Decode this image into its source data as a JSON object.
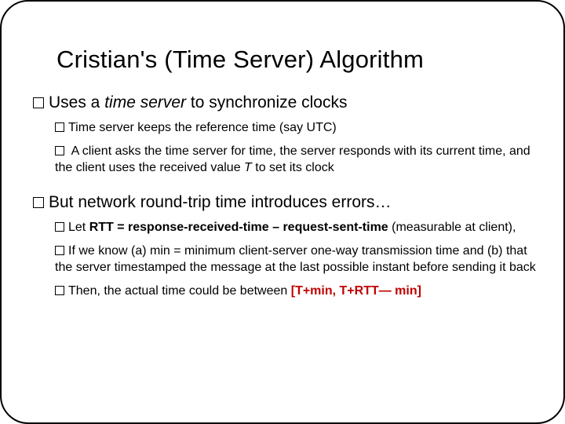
{
  "title": "Cristian's (Time Server) Algorithm",
  "bullets": {
    "b1_pre": "Uses a ",
    "b1_em": "time server",
    "b1_post": " to synchronize clocks",
    "b1a": "Time server keeps the reference time (say UTC)",
    "b1b_pre": " A client asks the time server for time, the server responds with its current time, and the client uses the received value ",
    "b1b_em": "T",
    "b1b_post": " to set its clock",
    "b2": "But network round-trip time introduces errors…",
    "b2a_pre": "Let ",
    "b2a_bold": "RTT = response-received-time – request-sent-time",
    "b2a_post": " (measurable at client),",
    "b2b": "If we know (a) min = minimum client-server one-way transmission time and (b) that the server timestamped the message at the last possible instant before sending it back",
    "b2c_pre": "Then, the actual time could be between ",
    "b2c_red": "[T+min, T+RTT— min]"
  }
}
